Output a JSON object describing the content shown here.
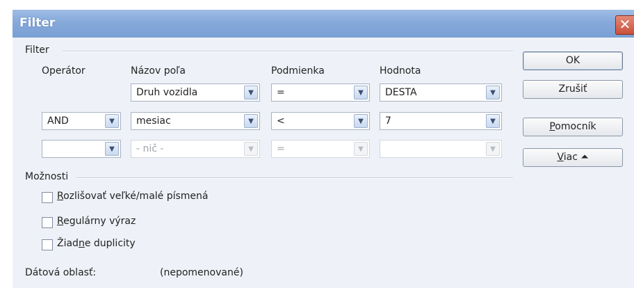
{
  "window": {
    "title": "Filter",
    "close_glyph": "✕"
  },
  "filter_group": {
    "title": "Filter",
    "headers": {
      "operator": "Operátor",
      "field_name": "Názov poľa",
      "condition": "Podmienka",
      "value": "Hodnota"
    },
    "rows": [
      {
        "operator": "",
        "field": "Druh vozidla",
        "condition": "=",
        "value": "DESTA",
        "enabled": true
      },
      {
        "operator": "AND",
        "field": "mesiac",
        "condition": "<",
        "value": "7",
        "enabled": true
      },
      {
        "operator": "",
        "field": "- nič -",
        "condition": "=",
        "value": "",
        "enabled": false
      }
    ]
  },
  "options_group": {
    "title": "Možnosti",
    "case_sensitive": {
      "pre": "",
      "key": "R",
      "post": "ozlišovať veľké/malé písmená",
      "checked": false
    },
    "regex": {
      "pre": "",
      "key": "R",
      "post": "egulárny výraz",
      "checked": false
    },
    "no_duplicates": {
      "pre": "Žiad",
      "key": "n",
      "post": "e duplicity",
      "checked": false
    }
  },
  "data_range": {
    "label": "Dátová oblasť:",
    "value": "(nepomenované)"
  },
  "buttons": {
    "ok": "OK",
    "cancel": "Zrušiť",
    "help_pre": "",
    "help_key": "P",
    "help_post": "omocník",
    "more_pre": "",
    "more_key": "V",
    "more_post": "iac",
    "more_icon": "⏶"
  },
  "icons": {
    "dropdown": "chevron-down-icon",
    "close": "close-icon",
    "more": "double-chevron-up-icon"
  }
}
